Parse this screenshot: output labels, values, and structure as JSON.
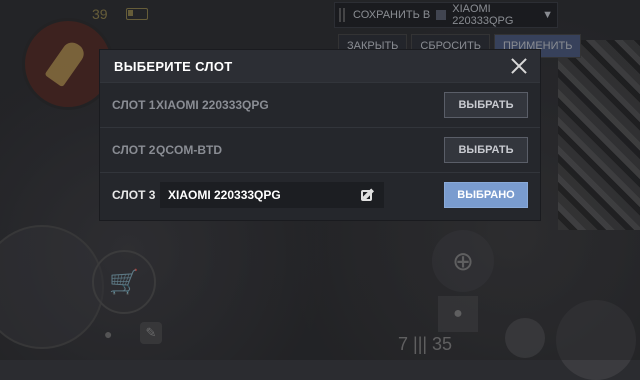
{
  "hud": {
    "ammo_top": "39",
    "ammo_bottom": "7 ||| 35",
    "save_bar": {
      "label": "СОХРАНИТЬ В",
      "device": "XIAOMI 220333QPG",
      "close": "ЗАКРЫТЬ",
      "reset": "СБРОСИТЬ",
      "apply": "ПРИМЕНИТЬ"
    }
  },
  "dialog": {
    "title": "ВЫБЕРИТЕ СЛОТ",
    "slots": [
      {
        "label": "СЛОТ 1",
        "name": "XIAOMI 220333QPG",
        "button": "ВЫБРАТЬ"
      },
      {
        "label": "СЛОТ 2",
        "name": "QCOM-BTD",
        "button": "ВЫБРАТЬ"
      },
      {
        "label": "СЛОТ 3",
        "name": "XIAOMI 220333QPG",
        "button": "ВЫБРАНО"
      }
    ]
  },
  "colors": {
    "selected_button": "#7a9ccf",
    "dialog_bg": "#25272c"
  },
  "icons": {
    "close": "close-icon",
    "edit": "edit-icon"
  }
}
